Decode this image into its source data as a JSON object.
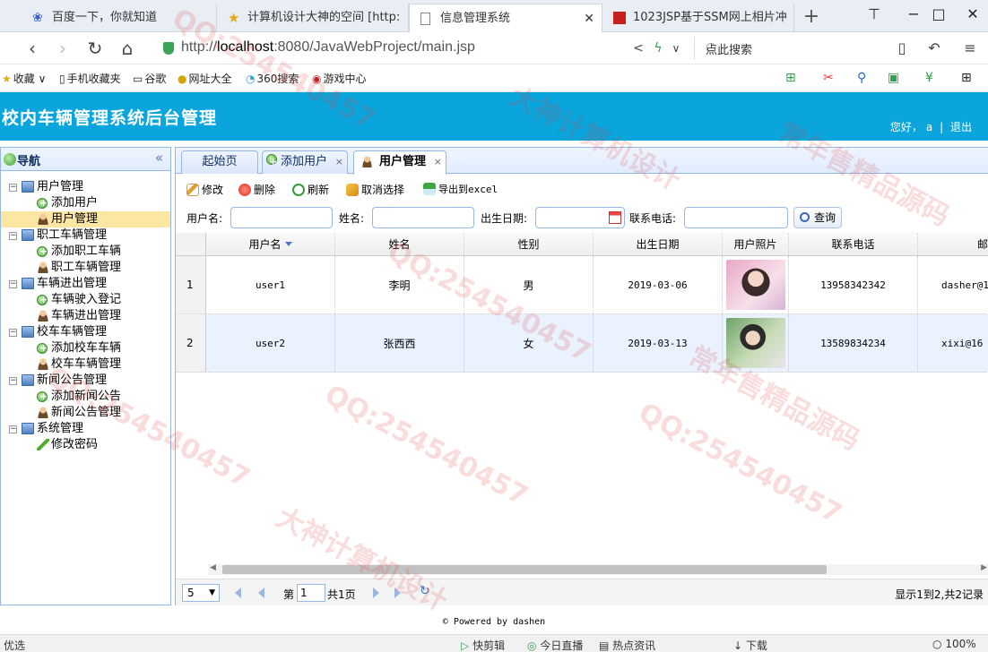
{
  "browser": {
    "tabs": [
      {
        "label": "百度一下，你就知道",
        "icon": "paw-icon"
      },
      {
        "label": "计算机设计大神的空间 [http:",
        "icon": "star-icon"
      },
      {
        "label": "信息管理系统",
        "icon": "page-icon",
        "active": true
      },
      {
        "label": "1023JSP基于SSM网上相片冲",
        "icon": "red-square-icon"
      }
    ],
    "url_prefix": "http://",
    "url_host": "localhost",
    "url_rest": ":8080/JavaWebProject/main.jsp",
    "search_placeholder": "点此搜索",
    "bookmarks": [
      "收藏",
      "手机收藏夹",
      "谷歌",
      "网址大全",
      "360搜索",
      "游戏中心"
    ]
  },
  "app": {
    "title": "校内车辆管理系统后台管理",
    "greeting": "您好，",
    "user": "a",
    "separator": "|",
    "logout": "退出",
    "footer": "© Powered by dashen"
  },
  "nav": {
    "title": "导航",
    "groups": [
      {
        "label": "用户管理",
        "items": [
          {
            "label": "添加用户",
            "icon": "add-icon"
          },
          {
            "label": "用户管理",
            "icon": "user-icon",
            "selected": true
          }
        ]
      },
      {
        "label": "职工车辆管理",
        "items": [
          {
            "label": "添加职工车辆",
            "icon": "add-icon"
          },
          {
            "label": "职工车辆管理",
            "icon": "user-icon"
          }
        ]
      },
      {
        "label": "车辆进出管理",
        "items": [
          {
            "label": "车辆驶入登记",
            "icon": "add-icon"
          },
          {
            "label": "车辆进出管理",
            "icon": "user-icon"
          }
        ]
      },
      {
        "label": "校车车辆管理",
        "items": [
          {
            "label": "添加校车车辆",
            "icon": "add-icon"
          },
          {
            "label": "校车车辆管理",
            "icon": "user-icon"
          }
        ]
      },
      {
        "label": "新闻公告管理",
        "items": [
          {
            "label": "添加新闻公告",
            "icon": "add-icon"
          },
          {
            "label": "新闻公告管理",
            "icon": "user-icon"
          }
        ]
      },
      {
        "label": "系统管理",
        "items": [
          {
            "label": "修改密码",
            "icon": "pencil-icon"
          }
        ]
      }
    ]
  },
  "tabs": [
    {
      "label": "起始页",
      "closable": false
    },
    {
      "label": "添加用户",
      "closable": true
    },
    {
      "label": "用户管理",
      "closable": true,
      "active": true
    }
  ],
  "toolbar": {
    "edit": "修改",
    "delete": "删除",
    "refresh": "刷新",
    "unselect": "取消选择",
    "export": "导出到excel"
  },
  "search": {
    "username_label": "用户名:",
    "name_label": "姓名:",
    "birth_label": "出生日期:",
    "phone_label": "联系电话:",
    "query_label": "查询"
  },
  "grid": {
    "columns": [
      "用户名",
      "姓名",
      "性别",
      "出生日期",
      "用户照片",
      "联系电话",
      "邮箱"
    ],
    "rows": [
      {
        "num": "1",
        "username": "user1",
        "name": "李明",
        "gender": "男",
        "birth": "2019-03-06",
        "photo": "photo",
        "phone": "13958342342",
        "email": "dasher@1"
      },
      {
        "num": "2",
        "username": "user2",
        "name": "张西西",
        "gender": "女",
        "birth": "2019-03-13",
        "photo": "photo",
        "phone": "13589834234",
        "email": "xixi@16"
      }
    ]
  },
  "pager": {
    "page_size": "5",
    "page_prefix": "第",
    "page_value": "1",
    "page_suffix": "共1页",
    "info": "显示1到2,共2记录"
  },
  "statusbar": {
    "left": "优选",
    "items": [
      "快剪辑",
      "今日直播",
      "热点资讯",
      "下载",
      "100%"
    ]
  },
  "watermarks": [
    "QQ:254540457",
    "大神计算机设计",
    "常年售精品源码"
  ]
}
